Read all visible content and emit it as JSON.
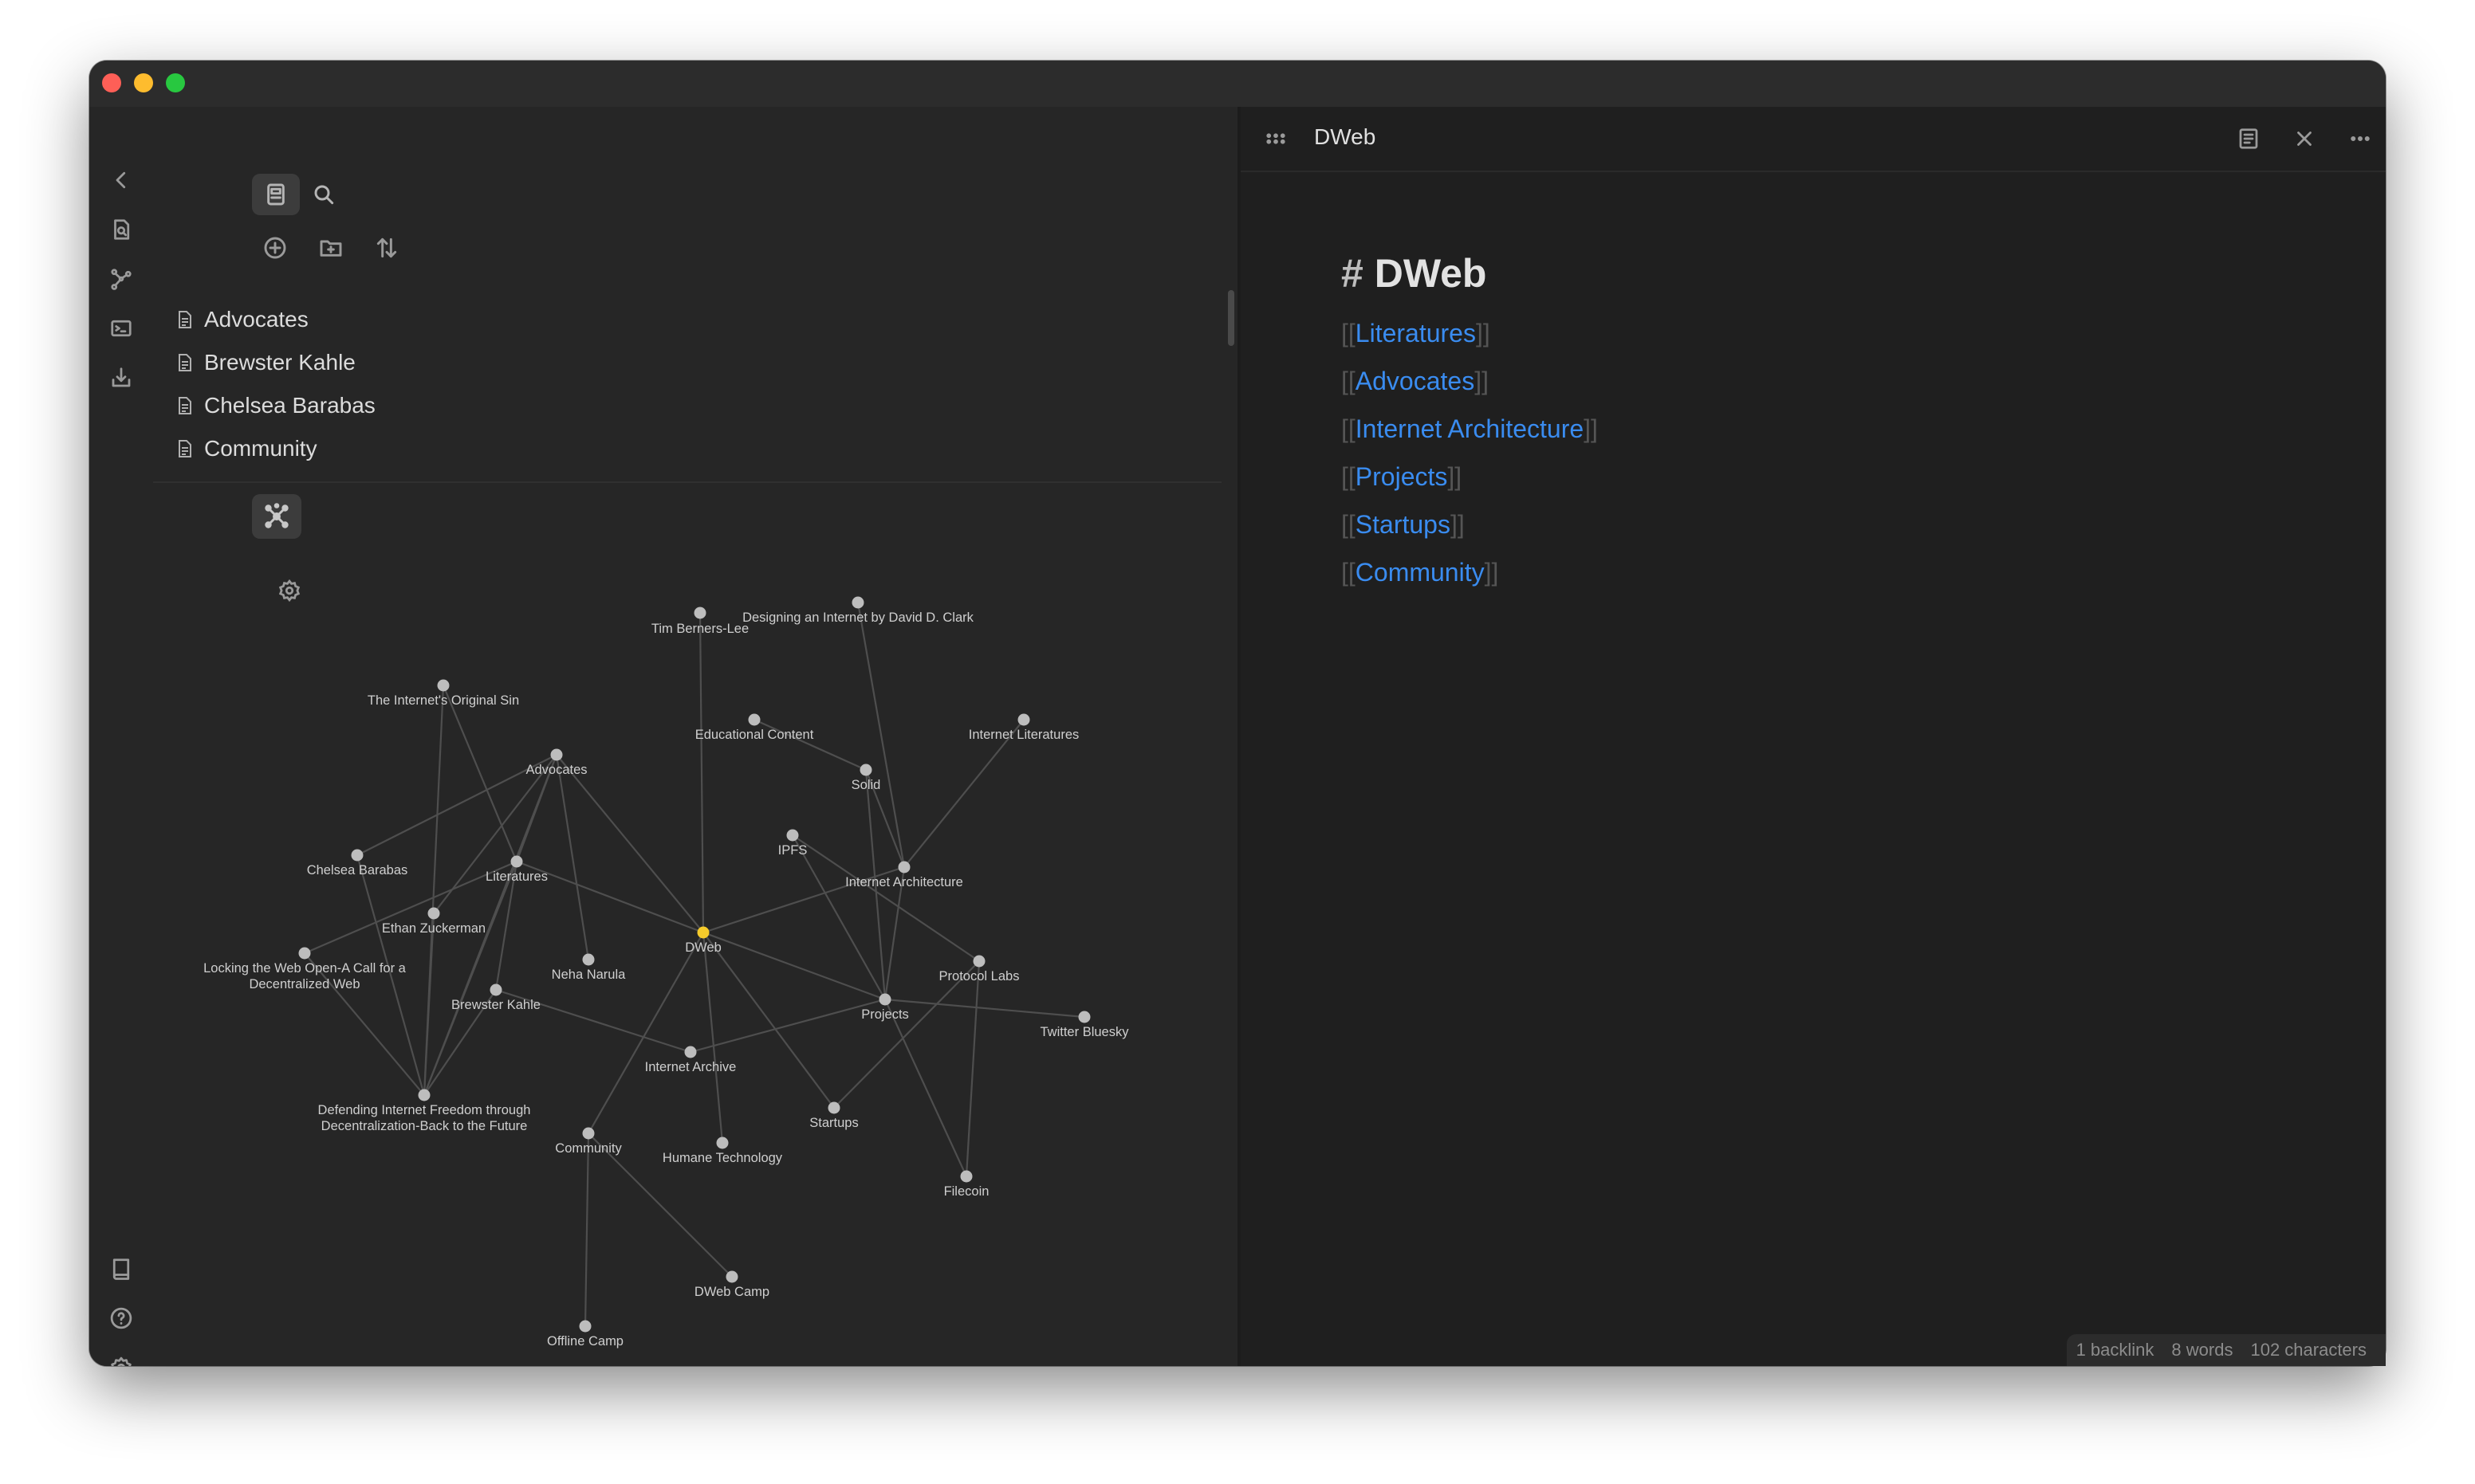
{
  "window": {
    "colors": {
      "close": "#fe5f57",
      "minimize": "#febc2e",
      "zoom": "#28c840",
      "accent_link": "#3a8cf0",
      "active_node": "#f5cb2b"
    }
  },
  "ribbon": {
    "top_icons": [
      "collapse-chevron-left-icon",
      "quick-switcher-icon",
      "graph-view-icon",
      "command-palette-icon",
      "import-icon"
    ],
    "bottom_icons": [
      "vault-icon",
      "help-icon",
      "settings-gear-icon"
    ]
  },
  "sidebar": {
    "tabs": [
      "file-explorer-icon",
      "search-icon"
    ],
    "actions": [
      "new-note-icon",
      "new-folder-icon",
      "sort-icon"
    ],
    "files": [
      {
        "name": "Advocates"
      },
      {
        "name": "Brewster Kahle"
      },
      {
        "name": "Chelsea Barabas"
      },
      {
        "name": "Community"
      }
    ]
  },
  "graph": {
    "settings_icon": "gear-icon",
    "nodes": [
      {
        "id": "tbl",
        "label": "Tim Berners-Lee"
      },
      {
        "id": "clark",
        "label": "Designing an Internet by David D. Clark"
      },
      {
        "id": "sin",
        "label": "The Internet's Original Sin"
      },
      {
        "id": "edu",
        "label": "Educational Content"
      },
      {
        "id": "ilit",
        "label": "Internet Literatures"
      },
      {
        "id": "adv",
        "label": "Advocates"
      },
      {
        "id": "solid",
        "label": "Solid"
      },
      {
        "id": "ipfs",
        "label": "IPFS"
      },
      {
        "id": "chelsea",
        "label": "Chelsea Barabas"
      },
      {
        "id": "lit",
        "label": "Literatures"
      },
      {
        "id": "iarch",
        "label": "Internet Architecture"
      },
      {
        "id": "ethan",
        "label": "Ethan Zuckerman"
      },
      {
        "id": "dweb",
        "label": "DWeb",
        "active": true
      },
      {
        "id": "lock",
        "label": "Locking the Web Open-A Call for a|Decentralized Web"
      },
      {
        "id": "neha",
        "label": "Neha Narula"
      },
      {
        "id": "plabs",
        "label": "Protocol Labs"
      },
      {
        "id": "brewster",
        "label": "Brewster Kahle"
      },
      {
        "id": "projects",
        "label": "Projects"
      },
      {
        "id": "twitter",
        "label": "Twitter Bluesky"
      },
      {
        "id": "iarchive",
        "label": "Internet Archive"
      },
      {
        "id": "defend",
        "label": "Defending Internet Freedom through|Decentralization-Back to the Future"
      },
      {
        "id": "startups",
        "label": "Startups"
      },
      {
        "id": "community",
        "label": "Community"
      },
      {
        "id": "humane",
        "label": "Humane Technology"
      },
      {
        "id": "filecoin",
        "label": "Filecoin"
      },
      {
        "id": "dwebcamp",
        "label": "DWeb Camp"
      },
      {
        "id": "offline",
        "label": "Offline Camp"
      }
    ],
    "edges": [
      [
        "tbl",
        "dweb"
      ],
      [
        "clark",
        "iarch"
      ],
      [
        "ilit",
        "iarch"
      ],
      [
        "edu",
        "solid"
      ],
      [
        "solid",
        "iarch"
      ],
      [
        "solid",
        "projects"
      ],
      [
        "ipfs",
        "projects"
      ],
      [
        "ipfs",
        "plabs"
      ],
      [
        "iarch",
        "dweb"
      ],
      [
        "iarch",
        "projects"
      ],
      [
        "adv",
        "dweb"
      ],
      [
        "adv",
        "chelsea"
      ],
      [
        "adv",
        "lit"
      ],
      [
        "adv",
        "ethan"
      ],
      [
        "adv",
        "neha"
      ],
      [
        "adv",
        "defend"
      ],
      [
        "sin",
        "lit"
      ],
      [
        "sin",
        "defend"
      ],
      [
        "lit",
        "dweb"
      ],
      [
        "lit",
        "lock"
      ],
      [
        "lit",
        "defend"
      ],
      [
        "chelsea",
        "defend"
      ],
      [
        "lock",
        "defend"
      ],
      [
        "ethan",
        "defend"
      ],
      [
        "brewster",
        "defend"
      ],
      [
        "brewster",
        "iarchive"
      ],
      [
        "brewster",
        "lit"
      ],
      [
        "dweb",
        "projects"
      ],
      [
        "dweb",
        "humane"
      ],
      [
        "dweb",
        "startups"
      ],
      [
        "dweb",
        "community"
      ],
      [
        "projects",
        "twitter"
      ],
      [
        "projects",
        "iarchive"
      ],
      [
        "projects",
        "filecoin"
      ],
      [
        "plabs",
        "filecoin"
      ],
      [
        "plabs",
        "startups"
      ],
      [
        "community",
        "dwebcamp"
      ],
      [
        "community",
        "offline"
      ]
    ]
  },
  "editor": {
    "tab_title": "DWeb",
    "header_icons": [
      "tabs-grid-icon",
      "reading-view-icon",
      "close-icon",
      "more-options-icon"
    ],
    "heading_hash": "#",
    "heading_text": "DWeb",
    "open_bracket": "[[",
    "close_bracket": "]]",
    "links": [
      "Literatures",
      "Advocates",
      "Internet Architecture",
      "Projects",
      "Startups",
      "Community"
    ]
  },
  "status": {
    "backlinks": "1 backlink",
    "words": "8 words",
    "characters": "102 characters"
  }
}
